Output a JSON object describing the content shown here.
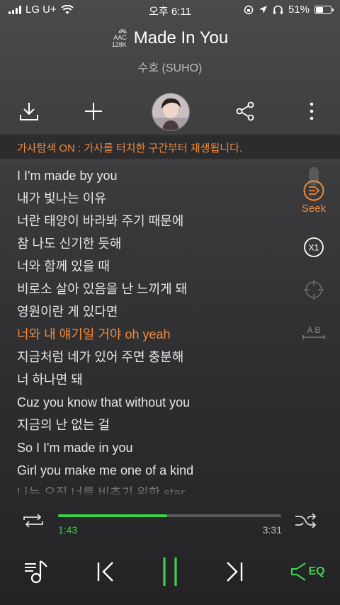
{
  "status_bar": {
    "carrier": "LG U+",
    "time": "오후 6:11",
    "battery": "51%",
    "battery_level": 0.51
  },
  "header": {
    "codec_line1": "AAC",
    "codec_line2": "128K",
    "title": "Made In You",
    "artist": "수호 (SUHO)"
  },
  "actions": {
    "download_icon": "download-icon",
    "add_icon": "plus-icon",
    "share_icon": "share-icon",
    "more_icon": "more-vertical-icon"
  },
  "notice": "가사탐색 ON : 가사를 터치한 구간부터 재생됩니다.",
  "lyrics": [
    "I I'm made by you",
    "내가 빛나는 이유",
    "너란 태양이 바라봐 주기 때문에",
    "참 나도 신기한 듯해",
    "너와 함께 있을 때",
    "비로소 살아 있음을 난 느끼게 돼",
    "영원이란 게 있다면",
    "너와 내 얘기일 거야 oh yeah",
    "지금처럼 네가 있어 주면 충분해",
    "너 하나면 돼",
    "Cuz you know that without you",
    "지금의 난 없는 걸",
    "So I I'm made in you",
    "Girl you make me one of a kind",
    "나는 오직 너를 비추기 위한 star"
  ],
  "active_lyric_index": 7,
  "side_controls": {
    "seek_label": "Seek",
    "speed_label": "X1",
    "ab_label": "A B"
  },
  "progress": {
    "elapsed": "1:43",
    "total": "3:31",
    "fraction": 0.49
  },
  "bottom": {
    "eq_label": "EQ"
  },
  "colors": {
    "accent_orange": "#f08a3c",
    "accent_green": "#3bd24b"
  }
}
